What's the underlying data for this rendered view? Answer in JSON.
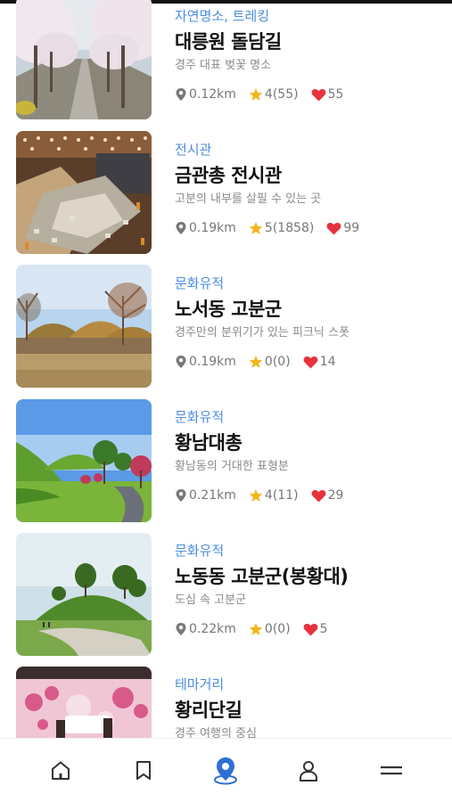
{
  "accent": "#4a8ee0",
  "items": [
    {
      "category": "자연명소, 트레킹",
      "title": "대릉원 돌담길",
      "desc": "경주 대표 벚꽃 명소",
      "distance": "0.12km",
      "rating": "4(55)",
      "likes": "55",
      "image": "cherry-blossom-road"
    },
    {
      "category": "전시관",
      "title": "금관총 전시관",
      "desc": "고분의 내부를 살필 수 있는 곳",
      "distance": "0.19km",
      "rating": "5(1858)",
      "likes": "99",
      "image": "tomb-exhibition-hall"
    },
    {
      "category": "문화유적",
      "title": "노서동 고분군",
      "desc": "경주만의 분위기가 있는 피크닉 스폿",
      "distance": "0.19km",
      "rating": "0(0)",
      "likes": "14",
      "image": "tumuli-field"
    },
    {
      "category": "문화유적",
      "title": "황남대총",
      "desc": "황남동의 거대한 표형분",
      "distance": "0.21km",
      "rating": "4(11)",
      "likes": "29",
      "image": "green-mounds-path"
    },
    {
      "category": "문화유적",
      "title": "노동동 고분군(봉황대)",
      "desc": "도심 속 고분군",
      "distance": "0.22km",
      "rating": "0(0)",
      "likes": "5",
      "image": "mound-with-trees"
    },
    {
      "category": "테마거리",
      "title": "황리단길",
      "desc": "경주 여행의 중심",
      "distance": "",
      "rating": "",
      "likes": "",
      "image": "mural-street"
    }
  ],
  "nav": [
    "home-icon",
    "bookmark-icon",
    "map-pin-icon",
    "person-icon",
    "menu-icon"
  ],
  "colors": {
    "heart": "#e8323c",
    "star": "#f2b51c",
    "pin": "#777777"
  }
}
